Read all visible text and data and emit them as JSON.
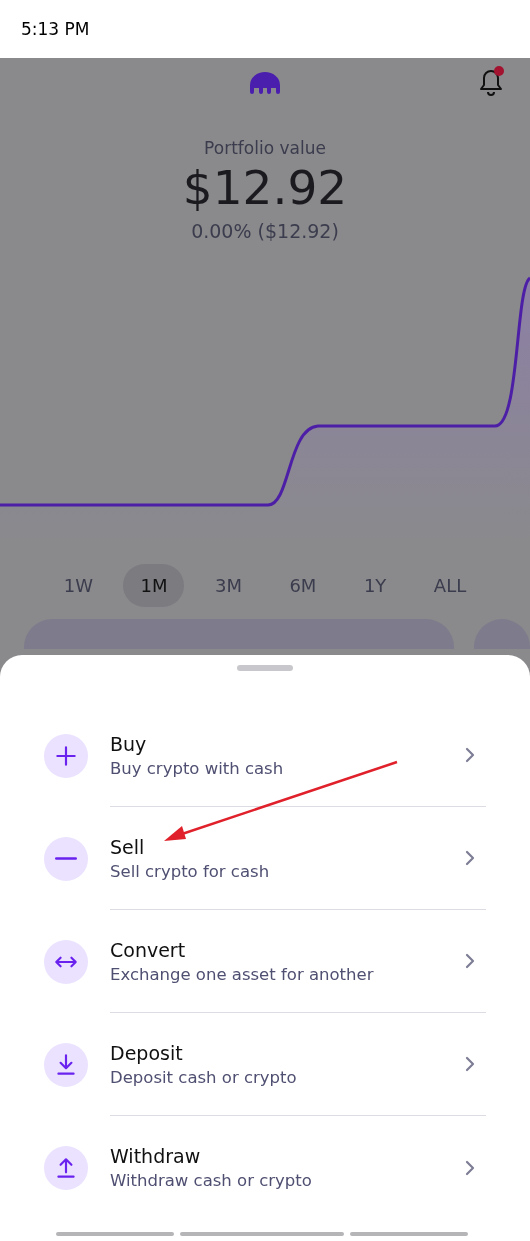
{
  "status_bar": {
    "time": "5:13 PM"
  },
  "header": {
    "notification_dot": true
  },
  "portfolio": {
    "label": "Portfolio value",
    "value": "$12.92",
    "change": "0.00% ($12.92)"
  },
  "range_tabs": [
    {
      "label": "1W",
      "selected": false
    },
    {
      "label": "1M",
      "selected": true
    },
    {
      "label": "3M",
      "selected": false
    },
    {
      "label": "6M",
      "selected": false
    },
    {
      "label": "1Y",
      "selected": false
    },
    {
      "label": "ALL",
      "selected": false
    }
  ],
  "actions": [
    {
      "kind": "buy",
      "title": "Buy",
      "subtitle": "Buy crypto with cash"
    },
    {
      "kind": "sell",
      "title": "Sell",
      "subtitle": "Sell crypto for cash"
    },
    {
      "kind": "convert",
      "title": "Convert",
      "subtitle": "Exchange one asset for another"
    },
    {
      "kind": "deposit",
      "title": "Deposit",
      "subtitle": "Deposit cash or crypto"
    },
    {
      "kind": "withdraw",
      "title": "Withdraw",
      "subtitle": "Withdraw cash or crypto"
    }
  ]
}
